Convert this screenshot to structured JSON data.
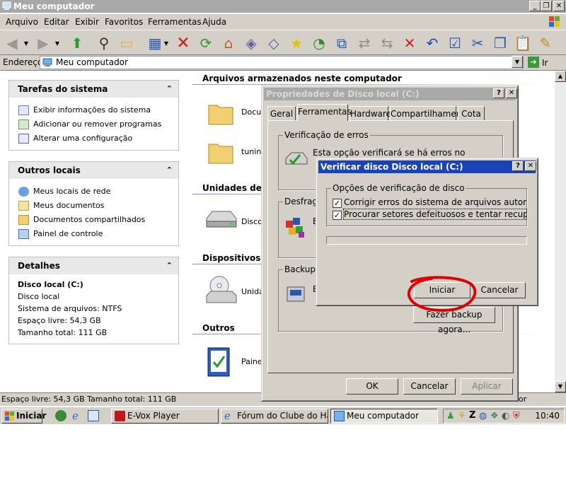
{
  "window": {
    "title": "Meu computador"
  },
  "menu": [
    "Arquivo",
    "Editar",
    "Exibir",
    "Favoritos",
    "Ferramentas",
    "Ajuda"
  ],
  "address": {
    "label": "Endereço",
    "value": "Meu computador",
    "go": "Ir"
  },
  "left": {
    "tasks": {
      "title": "Tarefas do sistema",
      "items": [
        "Exibir informações do sistema",
        "Adicionar ou remover programas",
        "Alterar uma configuração"
      ]
    },
    "places": {
      "title": "Outros locais",
      "items": [
        "Meus locais de rede",
        "Meus documentos",
        "Documentos compartilhados",
        "Painel de controle"
      ]
    },
    "details": {
      "title": "Detalhes",
      "name": "Disco local (C:)",
      "type": "Disco local",
      "fs": "Sistema de arquivos: NTFS",
      "free": "Espaço livre: 54,3 GB",
      "total": "Tamanho total: 111 GB"
    }
  },
  "main": {
    "stored_title": "Arquivos armazenados neste computador",
    "stored": [
      "Docum",
      "tuning"
    ],
    "drives_title": "Unidades de di",
    "drive": "Disco",
    "devices_title": "Dispositivos co",
    "device": "Unida",
    "others_title": "Outros",
    "other": "Paine"
  },
  "props": {
    "title": "Propriedades de Disco local (C:)",
    "tabs": [
      "Geral",
      "Ferramentas",
      "Hardware",
      "Compartilhamento",
      "Cota"
    ],
    "check_group": "Verificação de erros",
    "check_text": "Esta opção verificará se há erros no",
    "defrag_group": "Desfragm",
    "backup_group": "Backup",
    "backup_btn": "Fazer backup agora...",
    "ok": "OK",
    "cancel": "Cancelar",
    "apply": "Aplicar"
  },
  "check": {
    "title": "Verificar disco Disco local (C:)",
    "group": "Opções de verificação de disco",
    "opt1": "Corrigir erros do sistema de arquivos automaticament",
    "opt2": "Procurar setores defeituosos e tentar recuperá-lo",
    "start": "Iniciar",
    "cancel": "Cancelar"
  },
  "status": {
    "text": "Espaço livre: 54,3 GB Tamanho total: 111 GB",
    "right": "or"
  },
  "taskbar": {
    "start": "Iniciar",
    "tasks": [
      "E-Vox Player",
      "Fórum do Clube do Har...",
      "Meu computador"
    ],
    "clock": "10:40"
  },
  "colors": {
    "accent": "#1a43b8",
    "annotation": "#e00000"
  }
}
